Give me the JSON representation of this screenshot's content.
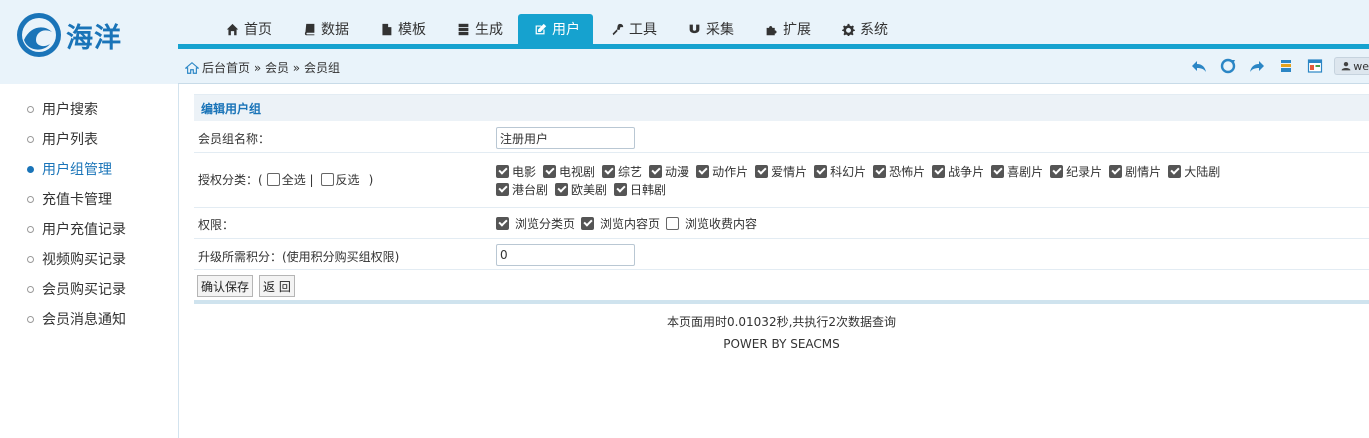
{
  "brand": {
    "logo_text": "海洋"
  },
  "nav": [
    {
      "label": "首页",
      "icon": "home-icon"
    },
    {
      "label": "数据",
      "icon": "book-icon"
    },
    {
      "label": "模板",
      "icon": "file-icon"
    },
    {
      "label": "生成",
      "icon": "server-icon"
    },
    {
      "label": "用户",
      "icon": "edit-icon",
      "active": true
    },
    {
      "label": "工具",
      "icon": "wrench-icon"
    },
    {
      "label": "采集",
      "icon": "magnet-icon"
    },
    {
      "label": "扩展",
      "icon": "puzzle-icon"
    },
    {
      "label": "系统",
      "icon": "gear-icon"
    }
  ],
  "breadcrumb": {
    "text": "后台首页 » 会员 » 会员组"
  },
  "toolbar": {
    "user_label": "we"
  },
  "sidebar": {
    "items": [
      {
        "label": "用户搜索"
      },
      {
        "label": "用户列表"
      },
      {
        "label": "用户组管理",
        "active": true
      },
      {
        "label": "充值卡管理"
      },
      {
        "label": "用户充值记录"
      },
      {
        "label": "视频购买记录"
      },
      {
        "label": "会员购买记录"
      },
      {
        "label": "会员消息通知"
      }
    ]
  },
  "form": {
    "title": "编辑用户组",
    "name_label": "会员组名称：",
    "name_value": "注册用户",
    "category_label_prefix": "授权分类：(",
    "select_all": "全选 |",
    "invert": "反选",
    "category_label_suffix": ")",
    "categories": [
      {
        "label": "电影",
        "checked": true
      },
      {
        "label": "电视剧",
        "checked": true
      },
      {
        "label": "综艺",
        "checked": true
      },
      {
        "label": "动漫",
        "checked": true
      },
      {
        "label": "动作片",
        "checked": true
      },
      {
        "label": "爱情片",
        "checked": true
      },
      {
        "label": "科幻片",
        "checked": true
      },
      {
        "label": "恐怖片",
        "checked": true
      },
      {
        "label": "战争片",
        "checked": true
      },
      {
        "label": "喜剧片",
        "checked": true
      },
      {
        "label": "纪录片",
        "checked": true
      },
      {
        "label": "剧情片",
        "checked": true
      },
      {
        "label": "大陆剧",
        "checked": true
      },
      {
        "label": "港台剧",
        "checked": true
      },
      {
        "label": "欧美剧",
        "checked": true
      },
      {
        "label": "日韩剧",
        "checked": true
      }
    ],
    "perm_label": "权限：",
    "permissions": [
      {
        "label": "浏览分类页",
        "checked": true
      },
      {
        "label": "浏览内容页",
        "checked": true
      },
      {
        "label": "浏览收费内容",
        "checked": false
      }
    ],
    "points_label": "升级所需积分：(使用积分购买组权限)",
    "points_value": "0",
    "save_label": "确认保存",
    "back_label": "返 回"
  },
  "footer": {
    "stats": "本页面用时0.01032秒,共执行2次数据查询",
    "power": "POWER BY SEACMS"
  },
  "colors": {
    "accent": "#16a2cf",
    "brand_blue": "#1a74b8",
    "header_bg": "#e9f3fa"
  }
}
